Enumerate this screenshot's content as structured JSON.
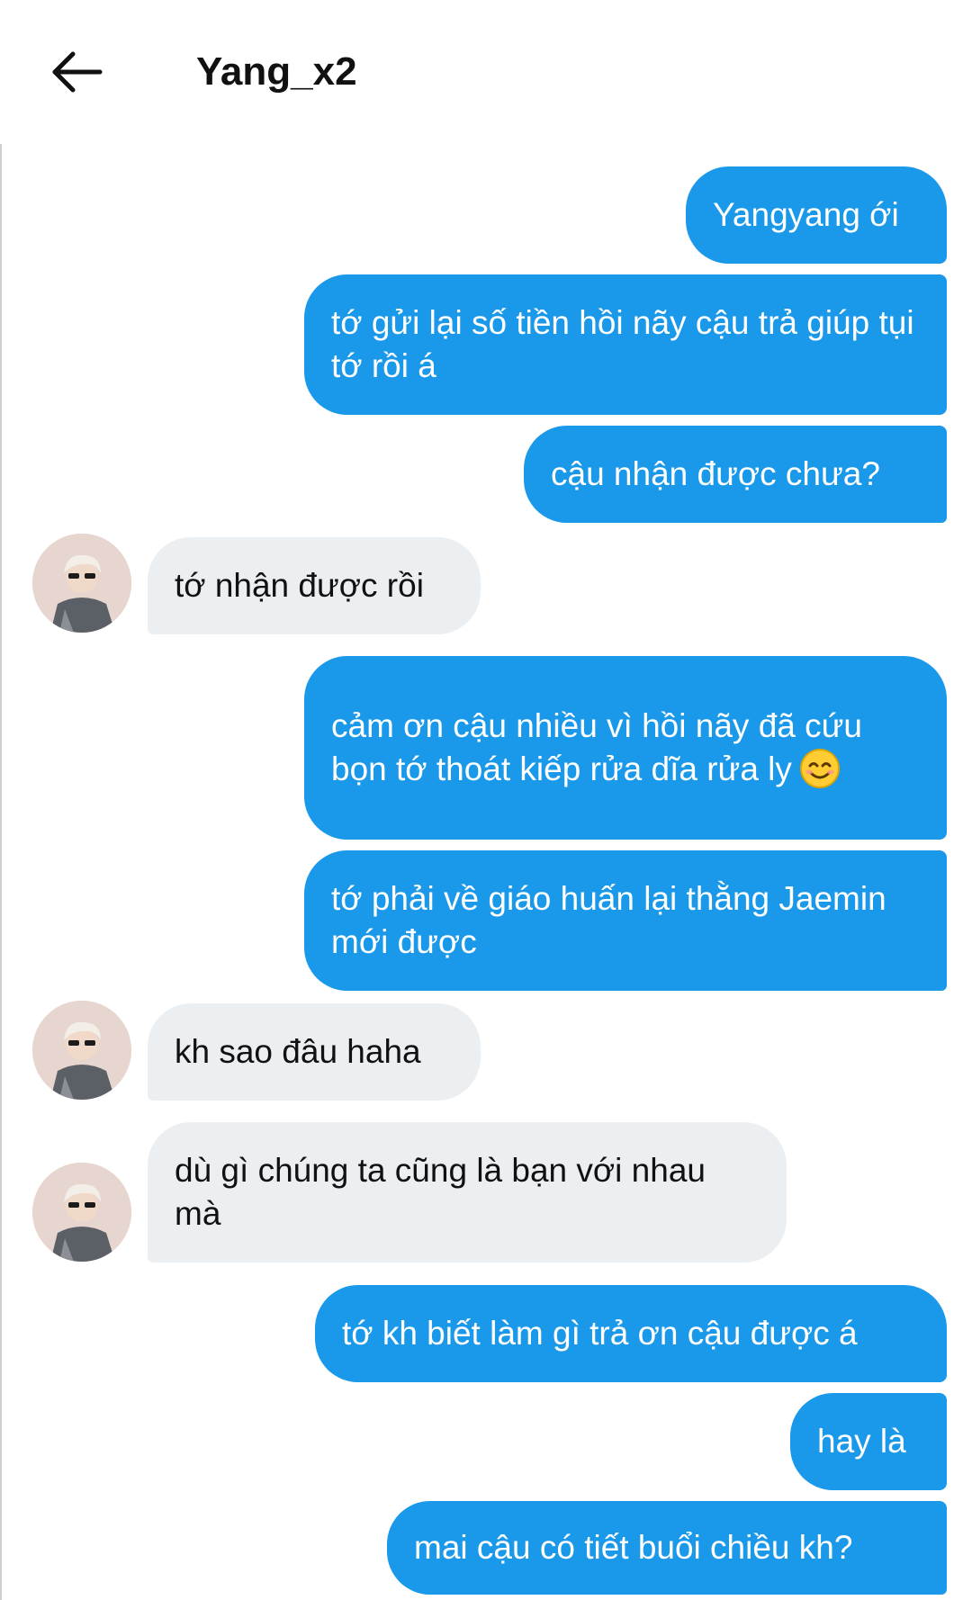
{
  "header": {
    "title": "Yang_x2"
  },
  "icons": {
    "back": "arrow-left-icon",
    "avatar": "profile-avatar",
    "emoji": "smiling-face-with-smiling-eyes"
  },
  "colors": {
    "outgoing_bubble": "#1a98e9",
    "incoming_bubble": "#eceff2",
    "background": "#ffffff"
  },
  "messages": [
    {
      "side": "out",
      "text": "Yangyang ới"
    },
    {
      "side": "out",
      "text": "tớ gửi lại số tiền hồi nãy cậu trả giúp tụi tớ rồi á"
    },
    {
      "side": "out",
      "text": "cậu nhận được chưa?"
    },
    {
      "side": "in",
      "text": "tớ nhận được rồi"
    },
    {
      "side": "out",
      "text": "cảm ơn cậu nhiều vì hồi nãy đã cứu bọn tớ thoát kiếp rửa dĩa rửa ly"
    },
    {
      "side": "out",
      "text": "tớ phải về giáo huấn lại thằng Jaemin mới được"
    },
    {
      "side": "in",
      "text": "kh sao đâu haha"
    },
    {
      "side": "in",
      "text": "dù gì chúng ta cũng là bạn với nhau mà"
    },
    {
      "side": "out",
      "text": "tớ kh biết làm gì trả ơn cậu được á"
    },
    {
      "side": "out",
      "text": "hay là"
    },
    {
      "side": "out",
      "text": "mai cậu có tiết buổi chiều kh?"
    }
  ]
}
